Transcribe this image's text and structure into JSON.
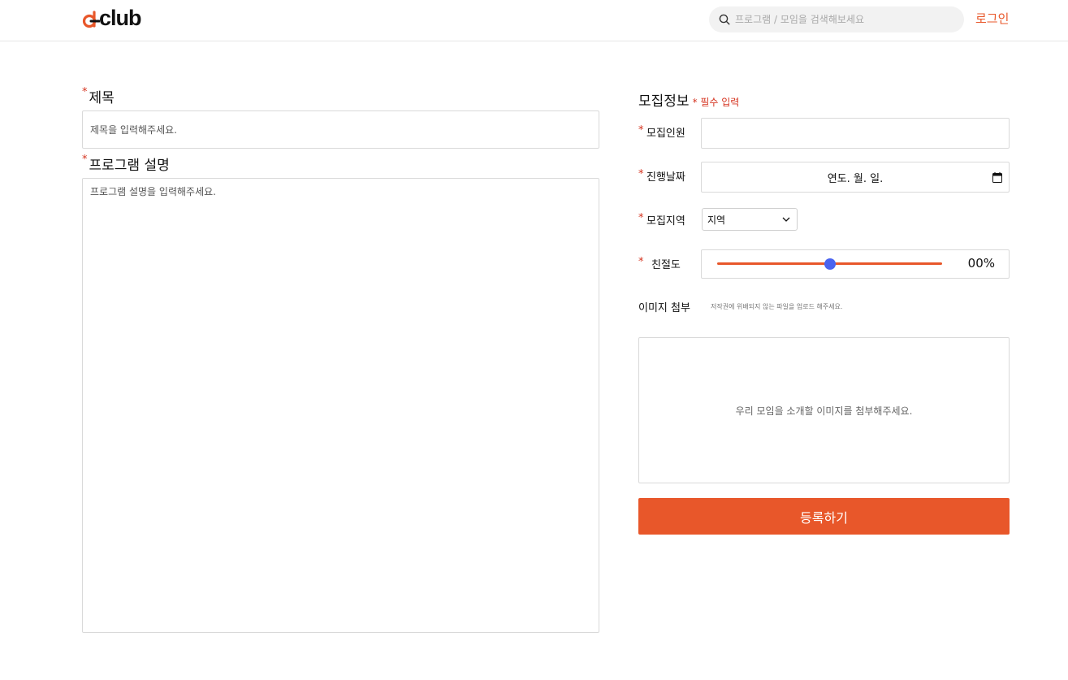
{
  "header": {
    "logo_text": "club",
    "search_placeholder": "프로그램 / 모임을 검색해보세요",
    "login_label": "로그인"
  },
  "form": {
    "required_mark": "*",
    "title_label": "제목",
    "title_placeholder": "제목을 입력해주세요.",
    "description_label": "프로그램 설명",
    "description_placeholder": "프로그램 설명을 입력해주세요."
  },
  "recruit": {
    "section_title": "모집정보",
    "required_note": "* 필수 입력",
    "headcount_label": "모집인원",
    "date_label": "진행날짜",
    "date_value": "연도. 월. 일.",
    "region_label": "모집지역",
    "region_value": "지역",
    "kindness_label": "친절도",
    "kindness_value_text": "00%",
    "kindness_level": 0.5,
    "image_label": "이미지 첨부",
    "image_hint": "저작권에 위배되지 않는 파일을 업로드 해주세요.",
    "upload_placeholder": "우리 모임을 소개할 이미지를 첨부해주세요.",
    "submit_label": "등록하기"
  },
  "colors": {
    "accent": "#e8572a",
    "required": "#d5331f",
    "slider_thumb": "#4a63f0"
  },
  "icons": {
    "search": "search-icon",
    "chevron": "chevron-down-icon",
    "calendar": "calendar-icon"
  }
}
